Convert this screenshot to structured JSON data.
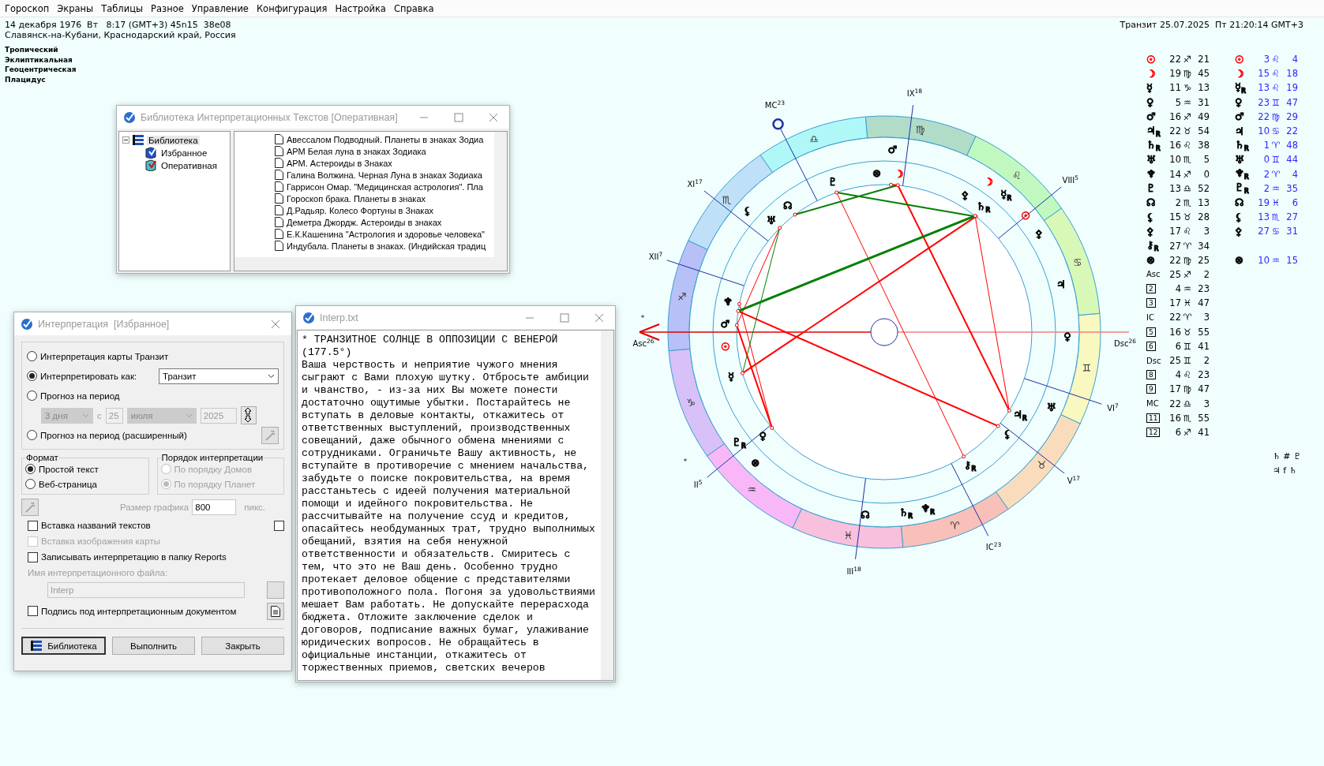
{
  "menu": [
    "Гороскоп",
    "Экраны",
    "Таблицы",
    "Разное",
    "Управление",
    "Конфигурация",
    "Настройка",
    "Справка"
  ],
  "chart_info": {
    "date_line": "14 декабря 1976  Вт   8:17 (GMT+3) 45n15  38e08",
    "place": "Славянск-на-Кубани, Краснодарский край, Россия",
    "settings": [
      "Тропический",
      "Эклиптикальная",
      "Геоцентрическая",
      "Плацидус"
    ]
  },
  "transit_info": "Транзит 25.07.2025  Пт 21:20:14 GMT+3",
  "library_window": {
    "title": "Библиотека Интерпретационных Текстов [Оперативная]",
    "tree": [
      {
        "label": "Библиотека",
        "expanded": true,
        "selected": true,
        "children": [
          {
            "label": "Избранное",
            "selected": false
          },
          {
            "label": "Оперативная",
            "selected": false
          }
        ]
      }
    ],
    "texts": [
      "Авессалом Подводный. Планеты в знаках Зодиа",
      "АРМ Белая луна в знаках Зодиака",
      "АРМ. Астероиды в Знаках",
      "Галина Волжина. Черная Луна в знаках Зодиака",
      "Гаррисон Омар. \"Медицинская астрология\". Пла",
      "Гороскоп брака. Планеты в знаках",
      "Д.Радьяр. Колесо Фортуны в Знаках",
      "Деметра Джордж. Астероиды в знаках",
      "Е.К.Кашенина \"Астрология и здоровье человека\"",
      "Индубала. Планеты в знаках. (Индийская традиц"
    ]
  },
  "dialog": {
    "title": "Интерпретация  [Избранное]",
    "modes": [
      {
        "label": "Интерпретация карты Транзит",
        "selected": false
      },
      {
        "label": "Интерпретировать как:",
        "selected": true
      },
      {
        "label": "Прогноз на период",
        "selected": false
      },
      {
        "label": "Прогноз на период (расширенный)",
        "selected": false
      }
    ],
    "interpret_as": "Транзит",
    "period": {
      "disabled": true,
      "length": "3 дня",
      "from_label": "с",
      "day": "25",
      "month": "июля",
      "year": "2025"
    },
    "format": {
      "title": "Формат",
      "options": [
        {
          "label": "Простой текст",
          "selected": true
        },
        {
          "label": "Веб-страница",
          "selected": false
        }
      ]
    },
    "order": {
      "title": "Порядок интерпретации",
      "disabled": true,
      "options": [
        {
          "label": "По порядку Домов",
          "selected": false
        },
        {
          "label": "По порядку Планет",
          "selected": true
        }
      ]
    },
    "graphic_size": {
      "label": "Размер графика",
      "value": "800",
      "unit": "пикс."
    },
    "checks": [
      {
        "label": "Вставка названий текстов",
        "checked": false,
        "disabled": false
      },
      {
        "label": "Вставка изображения карты",
        "checked": false,
        "disabled": true
      },
      {
        "label": "Записывать интерпретацию в папку Reports",
        "checked": false,
        "disabled": false
      }
    ],
    "extra_check": {
      "checked": false
    },
    "file_name": {
      "label": "Имя интерпретационного файла:",
      "value": "Interp"
    },
    "signature": {
      "label": "Подпись под интерпретационным документом",
      "checked": false
    },
    "buttons": [
      "Библиотека",
      "Выполнить",
      "Закрыть"
    ]
  },
  "interp_window": {
    "title": "Interp.txt",
    "lines": [
      "* ТРАНЗИТНОЕ СОЛНЦЕ В ОППОЗИЦИИ С ВЕНЕРОЙ",
      "(177.5°)",
      "Ваша черствость и неприятие чужого мнения",
      "сыграют с Вами плохую шутку. Отбросьте амбиции",
      "и чванство, - из-за них Вы можете понести",
      "достаточно ощутимые убытки. Постарайтесь не",
      "вступать в деловые контакты, откажитесь от",
      "ответственных выступлений, производственных",
      "совещаний, даже обычного обмена мнениями с",
      "сотрудниками. Ограничьте Вашу активность, не",
      "вступайте в противоречие с мнением начальства,",
      "забудьте о поиске покровительства, на время",
      "расстаньтесь с идеей получения материальной",
      "помощи и идейного покровительства. Не",
      "рассчитывайте на получение ссуд и кредитов,",
      "опасайтесь необдуманных трат, трудно выполнимых",
      "обещаний, взятия на себя ненужной",
      "ответственности и обязательств. Смиритесь с",
      "тем, что это не Ваш день. Особенно трудно",
      "протекает деловое общение с представителями",
      "противоположного пола. Погоня за удовольствиями",
      "мешает Вам работать. Не допускайте перерасхода",
      "бюджета. Отложите заключение сделок и",
      "договоров, подписание важных бумаг, улаживание",
      "юридических вопросов. Не обращайтесь в",
      "официальные инстанции, откажитесь от",
      "торжественных приемов, светских вечеров"
    ]
  },
  "chart": {
    "signs": [
      {
        "glyph": "♈",
        "color": "#f8c0b8"
      },
      {
        "glyph": "♉",
        "color": "#f8dcbc"
      },
      {
        "glyph": "♊",
        "color": "#f8f8c0"
      },
      {
        "glyph": "♋",
        "color": "#d8f8b8"
      },
      {
        "glyph": "♌",
        "color": "#c0f8c0"
      },
      {
        "glyph": "♍",
        "color": "#b0dcc8"
      },
      {
        "glyph": "♎",
        "color": "#b0f8f8"
      },
      {
        "glyph": "♏",
        "color": "#c0e0f8"
      },
      {
        "glyph": "♐",
        "color": "#b8c0f8"
      },
      {
        "glyph": "♑",
        "color": "#d8c0f8"
      },
      {
        "glyph": "♒",
        "color": "#f8b8f8"
      },
      {
        "glyph": "♓",
        "color": "#f8c0dc"
      }
    ],
    "houses": [
      "Asc$^{26}$",
      "II$^{5}$",
      "III$^{18}$",
      "IC$^{23}$",
      "V$^{17}$",
      "VI$^{7}$",
      "Dsc$^{26}$",
      "VIII$^{5}$",
      "IX$^{18}$",
      "MC$^{23}$",
      "XI$^{17}$",
      "XII$^{7}$"
    ],
    "natal": [
      {
        "glyph": "☉",
        "color": "#ff0000"
      },
      {
        "glyph": "☽",
        "color": "#ff0000"
      },
      {
        "glyph": "☿",
        "color": "#000000"
      },
      {
        "glyph": "♀",
        "color": "#000000"
      },
      {
        "glyph": "♂",
        "color": "#000000"
      },
      {
        "glyph": "♃$_{R}$",
        "color": "#000000"
      },
      {
        "glyph": "♄$_{R}$",
        "color": "#000000"
      },
      {
        "glyph": "♅",
        "color": "#000000"
      },
      {
        "glyph": "♆",
        "color": "#000000"
      },
      {
        "glyph": "♇",
        "color": "#000000"
      },
      {
        "glyph": "☊",
        "color": "#000000"
      },
      {
        "glyph": "⚸",
        "color": "#000000"
      },
      {
        "glyph": "⚴",
        "color": "#000000"
      },
      {
        "glyph": "⚷$_{R}$",
        "color": "#000000"
      },
      {
        "glyph": "⊗",
        "color": "#000000"
      }
    ],
    "transit": [
      {
        "glyph": "☉",
        "color": "#ff0000"
      },
      {
        "glyph": "☽",
        "color": "#ff0000"
      },
      {
        "glyph": "☿$_{R}$",
        "color": "#000000"
      },
      {
        "glyph": "♀",
        "color": "#000000"
      },
      {
        "glyph": "♂",
        "color": "#000000"
      },
      {
        "glyph": "♃",
        "color": "#000000"
      },
      {
        "glyph": "♄$_{R}$",
        "color": "#000000"
      },
      {
        "glyph": "♅",
        "color": "#000000"
      },
      {
        "glyph": "♆$_{R}$",
        "color": "#000000"
      },
      {
        "glyph": "♇$_{R}$",
        "color": "#000000"
      },
      {
        "glyph": "☊",
        "color": "#000000"
      },
      {
        "glyph": "⚸",
        "color": "#000000"
      },
      {
        "glyph": "⚴",
        "color": "#000000"
      },
      {
        "glyph": "⊗",
        "color": "#000000"
      }
    ],
    "asterisks": [
      "*",
      "*"
    ]
  },
  "positions": [
    {
      "kind": "planet",
      "glyph": "☉",
      "color": "#ff0000",
      "deg": "22",
      "sign": "♐",
      "min": "21",
      "transit": {
        "glyph": "☉",
        "color": "#ff0000",
        "deg": "3",
        "sign": "♌",
        "min": "4"
      }
    },
    {
      "kind": "planet",
      "glyph": "☽",
      "color": "#ff0000",
      "deg": "19",
      "sign": "♍",
      "min": "45",
      "transit": {
        "glyph": "☽",
        "color": "#ff0000",
        "deg": "15",
        "sign": "♌",
        "min": "18"
      }
    },
    {
      "kind": "planet",
      "glyph": "☿",
      "color": "#000000",
      "deg": "11",
      "sign": "♑",
      "min": "13",
      "transit": {
        "glyph": "☿$_{R}$",
        "color": "#000000",
        "deg": "13",
        "sign": "♌",
        "min": "19"
      }
    },
    {
      "kind": "planet",
      "glyph": "♀",
      "color": "#000000",
      "deg": "5",
      "sign": "♒",
      "min": "31",
      "transit": {
        "glyph": "♀",
        "color": "#000000",
        "deg": "23",
        "sign": "♊",
        "min": "47"
      }
    },
    {
      "kind": "planet",
      "glyph": "♂",
      "color": "#000000",
      "deg": "16",
      "sign": "♐",
      "min": "49",
      "transit": {
        "glyph": "♂",
        "color": "#000000",
        "deg": "22",
        "sign": "♍",
        "min": "29"
      }
    },
    {
      "kind": "planet",
      "glyph": "♃$_{R}$",
      "color": "#000000",
      "deg": "22",
      "sign": "♉",
      "min": "54",
      "transit": {
        "glyph": "♃",
        "color": "#000000",
        "deg": "10",
        "sign": "♋",
        "min": "22"
      }
    },
    {
      "kind": "planet",
      "glyph": "♄$_{R}$",
      "color": "#000000",
      "deg": "16",
      "sign": "♌",
      "min": "38",
      "transit": {
        "glyph": "♄$_{R}$",
        "color": "#000000",
        "deg": "1",
        "sign": "♈",
        "min": "48"
      }
    },
    {
      "kind": "planet",
      "glyph": "♅",
      "color": "#000000",
      "deg": "10",
      "sign": "♏",
      "min": "5",
      "transit": {
        "glyph": "♅",
        "color": "#000000",
        "deg": "0",
        "sign": "♊",
        "min": "44"
      }
    },
    {
      "kind": "planet",
      "glyph": "♆",
      "color": "#000000",
      "deg": "14",
      "sign": "♐",
      "min": "0",
      "transit": {
        "glyph": "♆$_{R}$",
        "color": "#000000",
        "deg": "2",
        "sign": "♈",
        "min": "4"
      }
    },
    {
      "kind": "planet",
      "glyph": "♇",
      "color": "#000000",
      "deg": "13",
      "sign": "♎",
      "min": "52",
      "transit": {
        "glyph": "♇$_{R}$",
        "color": "#000000",
        "deg": "2",
        "sign": "♒",
        "min": "35"
      }
    },
    {
      "kind": "planet",
      "glyph": "☊",
      "color": "#000000",
      "deg": "2",
      "sign": "♏",
      "min": "13",
      "transit": {
        "glyph": "☊",
        "color": "#000000",
        "deg": "19",
        "sign": "♓",
        "min": "6"
      }
    },
    {
      "kind": "planet",
      "glyph": "⚸",
      "color": "#000000",
      "deg": "15",
      "sign": "♉",
      "min": "28",
      "transit": {
        "glyph": "⚸",
        "color": "#000000",
        "deg": "13",
        "sign": "♏",
        "min": "27"
      }
    },
    {
      "kind": "planet",
      "glyph": "⚴",
      "color": "#000000",
      "deg": "17",
      "sign": "♌",
      "min": "3",
      "transit": {
        "glyph": "⚴",
        "color": "#000000",
        "deg": "27",
        "sign": "♋",
        "min": "31"
      }
    },
    {
      "kind": "planet",
      "glyph": "⚷$_{R}$",
      "color": "#000000",
      "deg": "27",
      "sign": "♈",
      "min": "34"
    },
    {
      "kind": "planet",
      "glyph": "⊗",
      "color": "#000000",
      "deg": "22",
      "sign": "♍",
      "min": "25",
      "transit": {
        "glyph": "⊗",
        "color": "#000000",
        "deg": "10",
        "sign": "♒",
        "min": "15"
      }
    },
    {
      "kind": "angle",
      "glyph": "Asc",
      "deg": "25",
      "sign": "♐",
      "min": "2"
    },
    {
      "kind": "house",
      "glyph": "2",
      "deg": "4",
      "sign": "♒",
      "min": "23"
    },
    {
      "kind": "house",
      "glyph": "3",
      "deg": "17",
      "sign": "♓",
      "min": "47"
    },
    {
      "kind": "angle",
      "glyph": "IC",
      "deg": "22",
      "sign": "♈",
      "min": "3"
    },
    {
      "kind": "house",
      "glyph": "5",
      "deg": "16",
      "sign": "♉",
      "min": "55"
    },
    {
      "kind": "house",
      "glyph": "6",
      "deg": "6",
      "sign": "♊",
      "min": "41"
    },
    {
      "kind": "angle",
      "glyph": "Dsc",
      "deg": "25",
      "sign": "♊",
      "min": "2"
    },
    {
      "kind": "house",
      "glyph": "8",
      "deg": "4",
      "sign": "♌",
      "min": "23"
    },
    {
      "kind": "house",
      "glyph": "9",
      "deg": "17",
      "sign": "♍",
      "min": "47"
    },
    {
      "kind": "angle",
      "glyph": "MC",
      "deg": "22",
      "sign": "♎",
      "min": "3"
    },
    {
      "kind": "house",
      "glyph": "11",
      "deg": "16",
      "sign": "♏",
      "min": "55"
    },
    {
      "kind": "house",
      "glyph": "12",
      "deg": "6",
      "sign": "♐",
      "min": "41"
    }
  ],
  "aspect_notes": [
    "♄ # ♇",
    "♃ f ♄"
  ]
}
